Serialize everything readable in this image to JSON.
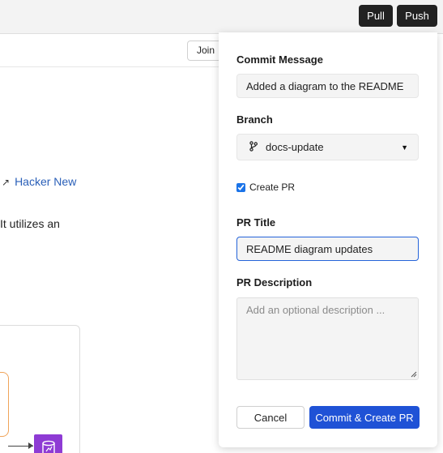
{
  "topbar": {
    "pull_label": "Pull",
    "push_label": "Push"
  },
  "background": {
    "join_button": "Join",
    "link_text": "Hacker New",
    "body_text": "It utilizes an"
  },
  "commit_panel": {
    "commit_message_label": "Commit Message",
    "commit_message_value": "Added a diagram to the README",
    "branch_label": "Branch",
    "branch_value": "docs-update",
    "create_pr_label": "Create PR",
    "create_pr_checked": true,
    "pr_title_label": "PR Title",
    "pr_title_value": "README diagram updates",
    "pr_description_label": "PR Description",
    "pr_description_placeholder": "Add an optional description ...",
    "cancel_label": "Cancel",
    "commit_button_label": "Commit & Create PR"
  },
  "colors": {
    "primary": "#1f52d6",
    "focus_border": "#2563d9",
    "topbar_button": "#222222",
    "diagram_icon": "#8e3bd4"
  },
  "icons": {
    "branch": "git-branch-icon",
    "caret": "caret-down-icon",
    "external_link": "external-link-arrow-icon",
    "database": "database-icon"
  }
}
